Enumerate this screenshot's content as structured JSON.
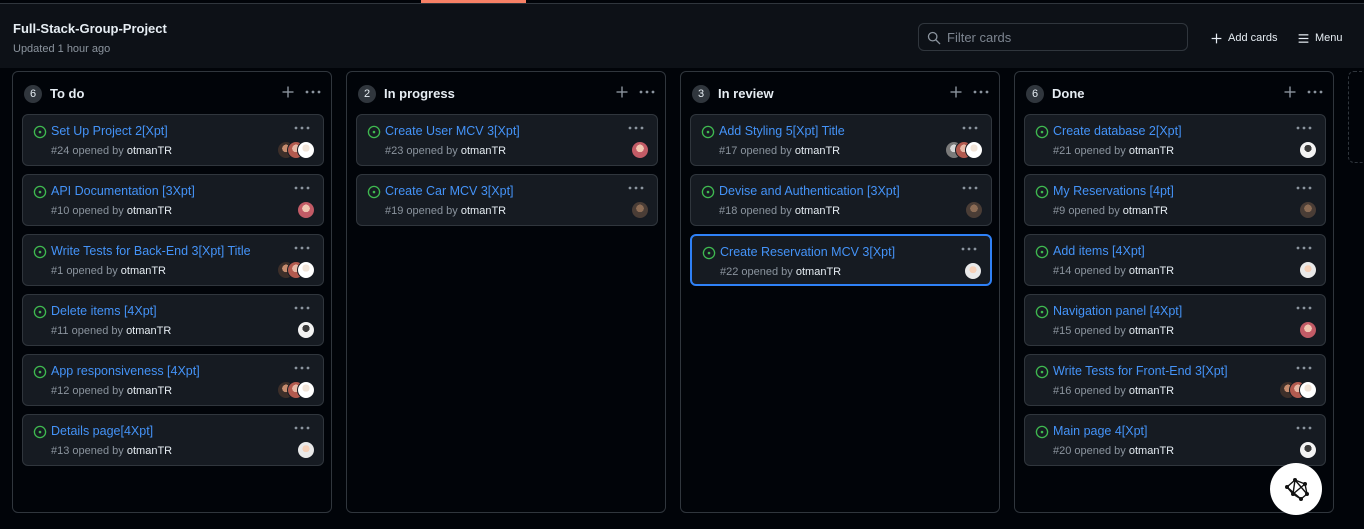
{
  "header": {
    "title": "Full-Stack-Group-Project",
    "updated": "Updated 1 hour ago",
    "filter_placeholder": "Filter cards",
    "add_cards_label": "Add cards",
    "menu_label": "Menu"
  },
  "icons": {
    "status": "issue-open-icon",
    "more": "kebab-horizontal-icon",
    "add": "plus-icon",
    "search": "search-icon",
    "menu": "hamburger-icon",
    "fab": "network-graph-icon"
  },
  "colors": {
    "accent": "#f78166",
    "link": "#4493f8",
    "open_status": "#3fb950",
    "selected_border": "#2f81f7"
  },
  "columns": [
    {
      "name": "To do",
      "count": "6",
      "cards": [
        {
          "title": "Set Up Project 2[Xpt]",
          "number": "#24",
          "opened_by": "opened by",
          "author": "otmanTR"
        },
        {
          "title": "API Documentation [3Xpt]",
          "number": "#10",
          "opened_by": "opened by",
          "author": "otmanTR"
        },
        {
          "title": "Write Tests for Back-End 3[Xpt] Title",
          "number": "#1",
          "opened_by": "opened by",
          "author": "otmanTR"
        },
        {
          "title": "Delete items [4Xpt]",
          "number": "#11",
          "opened_by": "opened by",
          "author": "otmanTR"
        },
        {
          "title": "App responsiveness [4Xpt]",
          "number": "#12",
          "opened_by": "opened by",
          "author": "otmanTR"
        },
        {
          "title": "Details page[4Xpt]",
          "number": "#13",
          "opened_by": "opened by",
          "author": "otmanTR"
        }
      ]
    },
    {
      "name": "In progress",
      "count": "2",
      "cards": [
        {
          "title": "Create User MCV 3[Xpt]",
          "number": "#23",
          "opened_by": "opened by",
          "author": "otmanTR"
        },
        {
          "title": "Create Car MCV 3[Xpt]",
          "number": "#19",
          "opened_by": "opened by",
          "author": "otmanTR"
        }
      ]
    },
    {
      "name": "In review",
      "count": "3",
      "cards": [
        {
          "title": "Add Styling 5[Xpt] Title",
          "number": "#17",
          "opened_by": "opened by",
          "author": "otmanTR"
        },
        {
          "title": "Devise and Authentication [3Xpt]",
          "number": "#18",
          "opened_by": "opened by",
          "author": "otmanTR"
        },
        {
          "title": "Create Reservation MCV 3[Xpt]",
          "number": "#22",
          "opened_by": "opened by",
          "author": "otmanTR"
        }
      ]
    },
    {
      "name": "Done",
      "count": "6",
      "cards": [
        {
          "title": "Create database 2[Xpt]",
          "number": "#21",
          "opened_by": "opened by",
          "author": "otmanTR"
        },
        {
          "title": "My Reservations [4pt]",
          "number": "#9",
          "opened_by": "opened by",
          "author": "otmanTR"
        },
        {
          "title": "Add items [4Xpt]",
          "number": "#14",
          "opened_by": "opened by",
          "author": "otmanTR"
        },
        {
          "title": "Navigation panel [4Xpt]",
          "number": "#15",
          "opened_by": "opened by",
          "author": "otmanTR"
        },
        {
          "title": "Write Tests for Front-End 3[Xpt]",
          "number": "#16",
          "opened_by": "opened by",
          "author": "otmanTR"
        },
        {
          "title": "Main page 4[Xpt]",
          "number": "#20",
          "opened_by": "opened by",
          "author": "otmanTR"
        }
      ]
    }
  ]
}
